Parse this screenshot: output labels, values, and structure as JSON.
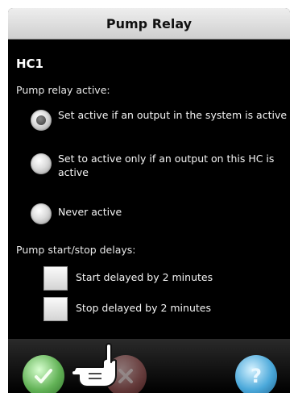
{
  "screen": {
    "title": "Pump Relay",
    "section": "HC1"
  },
  "relay": {
    "label": "Pump relay active:",
    "options": [
      {
        "label": "Set active if an output in the system is active",
        "selected": true
      },
      {
        "label": "Set to active only if an output on this HC is active",
        "selected": false
      },
      {
        "label": "Never active",
        "selected": false
      }
    ]
  },
  "delays": {
    "label": "Pump start/stop delays:",
    "options": [
      {
        "label": "Start delayed by 2 minutes",
        "checked": false
      },
      {
        "label": "Stop delayed by 2 minutes",
        "checked": false
      }
    ]
  },
  "buttons": {
    "ok_icon": "checkmark-icon",
    "cancel_icon": "x-icon",
    "help_icon": "question-icon",
    "ok_color": "#62b256",
    "cancel_color": "#b06464",
    "help_color": "#4aa8da",
    "help_glyph": "?"
  }
}
